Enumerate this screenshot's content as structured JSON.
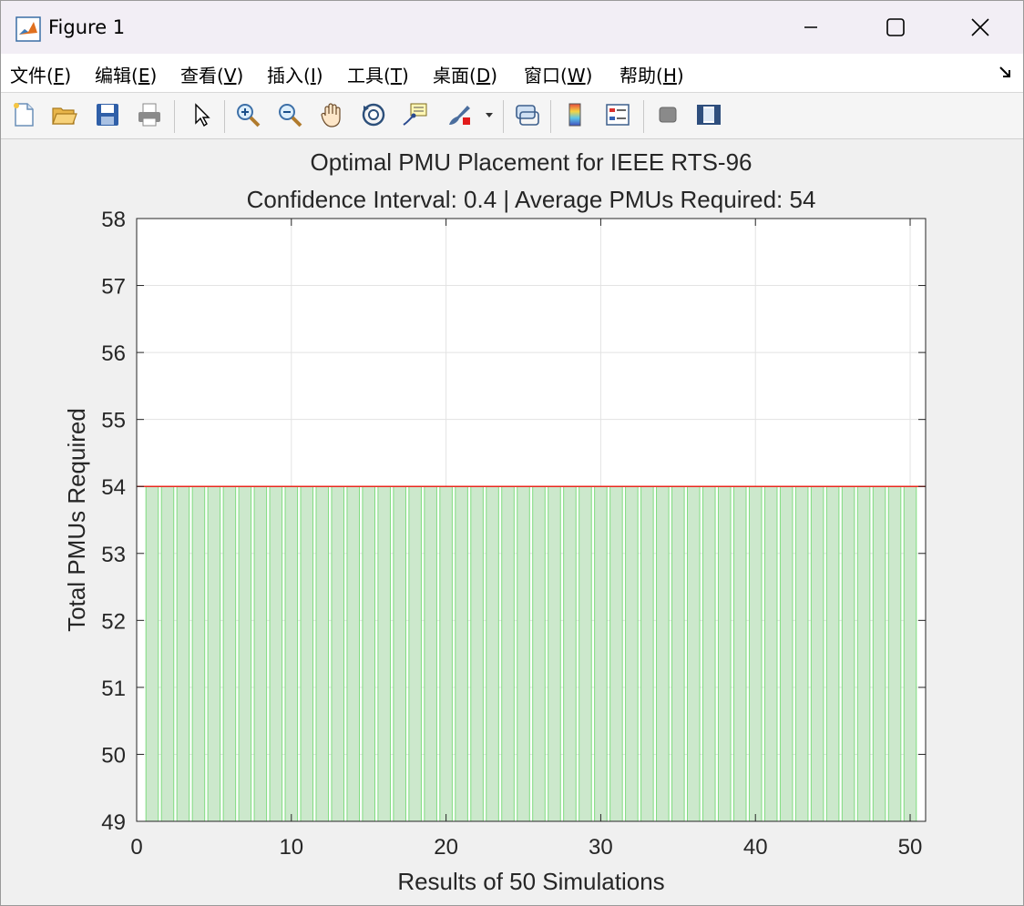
{
  "window": {
    "title": "Figure 1"
  },
  "menu": {
    "items": [
      {
        "label": "文件(",
        "key": "F",
        "suffix": ")"
      },
      {
        "label": "编辑(",
        "key": "E",
        "suffix": ")"
      },
      {
        "label": "查看(",
        "key": "V",
        "suffix": ")"
      },
      {
        "label": "插入(",
        "key": "I",
        "suffix": ")"
      },
      {
        "label": "工具(",
        "key": "T",
        "suffix": ")"
      },
      {
        "label": "桌面(",
        "key": "D",
        "suffix": ")"
      },
      {
        "label": "窗口(",
        "key": "W",
        "suffix": ")"
      },
      {
        "label": "帮助(",
        "key": "H",
        "suffix": ")"
      }
    ]
  },
  "toolbar": {
    "tools": [
      "new-figure-icon",
      "open-file-icon",
      "save-icon",
      "print-icon",
      "select-arrow-icon",
      "zoom-in-icon",
      "zoom-out-icon",
      "pan-hand-icon",
      "rotate-3d-icon",
      "data-tips-icon",
      "brush-icon",
      "link-plot-icon",
      "colorbar-icon",
      "legend-icon",
      "hide-plot-tools-icon",
      "show-plot-tools-icon"
    ]
  },
  "chart_data": {
    "type": "bar",
    "title": "Optimal PMU Placement for IEEE RTS-96",
    "subtitle": "Confidence Interval: 0.4 | Average PMUs Required: 54",
    "xlabel": "Results of 50 Simulations",
    "ylabel": "Total PMUs Required",
    "xlim": [
      0,
      51
    ],
    "ylim": [
      49,
      58
    ],
    "xticks": [
      0,
      10,
      20,
      30,
      40,
      50
    ],
    "yticks": [
      49,
      50,
      51,
      52,
      53,
      54,
      55,
      56,
      57,
      58
    ],
    "grid": true,
    "x": [
      1,
      2,
      3,
      4,
      5,
      6,
      7,
      8,
      9,
      10,
      11,
      12,
      13,
      14,
      15,
      16,
      17,
      18,
      19,
      20,
      21,
      22,
      23,
      24,
      25,
      26,
      27,
      28,
      29,
      30,
      31,
      32,
      33,
      34,
      35,
      36,
      37,
      38,
      39,
      40,
      41,
      42,
      43,
      44,
      45,
      46,
      47,
      48,
      49,
      50
    ],
    "values": [
      54,
      54,
      54,
      54,
      54,
      54,
      54,
      54,
      54,
      54,
      54,
      54,
      54,
      54,
      54,
      54,
      54,
      54,
      54,
      54,
      54,
      54,
      54,
      54,
      54,
      54,
      54,
      54,
      54,
      54,
      54,
      54,
      54,
      54,
      54,
      54,
      54,
      54,
      54,
      54,
      54,
      54,
      54,
      54,
      54,
      54,
      54,
      54,
      54,
      54
    ],
    "average_line": 54,
    "colors": {
      "bar_fill": "#cce8cc",
      "bar_edge": "#7fdc7f",
      "average_line": "#e8281e",
      "grid": "#e3e3e3"
    }
  }
}
